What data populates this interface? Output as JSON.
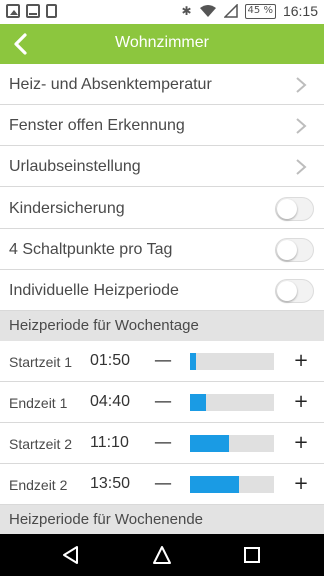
{
  "statusbar": {
    "icons": [
      "image-icon",
      "mail-icon",
      "phone-icon",
      "bluetooth-icon",
      "wifi-icon",
      "signal-icon",
      "battery-icon"
    ],
    "battery": "45 %",
    "clock": "16:15"
  },
  "header": {
    "title": "Wohnzimmer",
    "color": "#8cc63e"
  },
  "menu": {
    "items": [
      {
        "label": "Heiz- und Absenktemperatur"
      },
      {
        "label": "Fenster offen Erkennung"
      },
      {
        "label": "Urlaubseinstellung"
      }
    ],
    "toggles": [
      {
        "label": "Kindersicherung",
        "on": false
      },
      {
        "label": "4 Schaltpunkte pro Tag",
        "on": false
      },
      {
        "label": "Individuelle Heizperiode",
        "on": false
      }
    ]
  },
  "weekday_section": {
    "title": "Heizperiode für Wochentage",
    "rows": [
      {
        "label": "Startzeit 1",
        "time": "01:50",
        "minus": "—",
        "plus": "+",
        "progress": 0.07
      },
      {
        "label": "Endzeit 1",
        "time": "04:40",
        "minus": "—",
        "plus": "+",
        "progress": 0.19
      },
      {
        "label": "Startzeit 2",
        "time": "11:10",
        "minus": "—",
        "plus": "+",
        "progress": 0.47
      },
      {
        "label": "Endzeit 2",
        "time": "13:50",
        "minus": "—",
        "plus": "+",
        "progress": 0.58
      }
    ]
  },
  "weekend_section": {
    "title": "Heizperiode für Wochenende"
  },
  "accent_color": "#1a9be4"
}
